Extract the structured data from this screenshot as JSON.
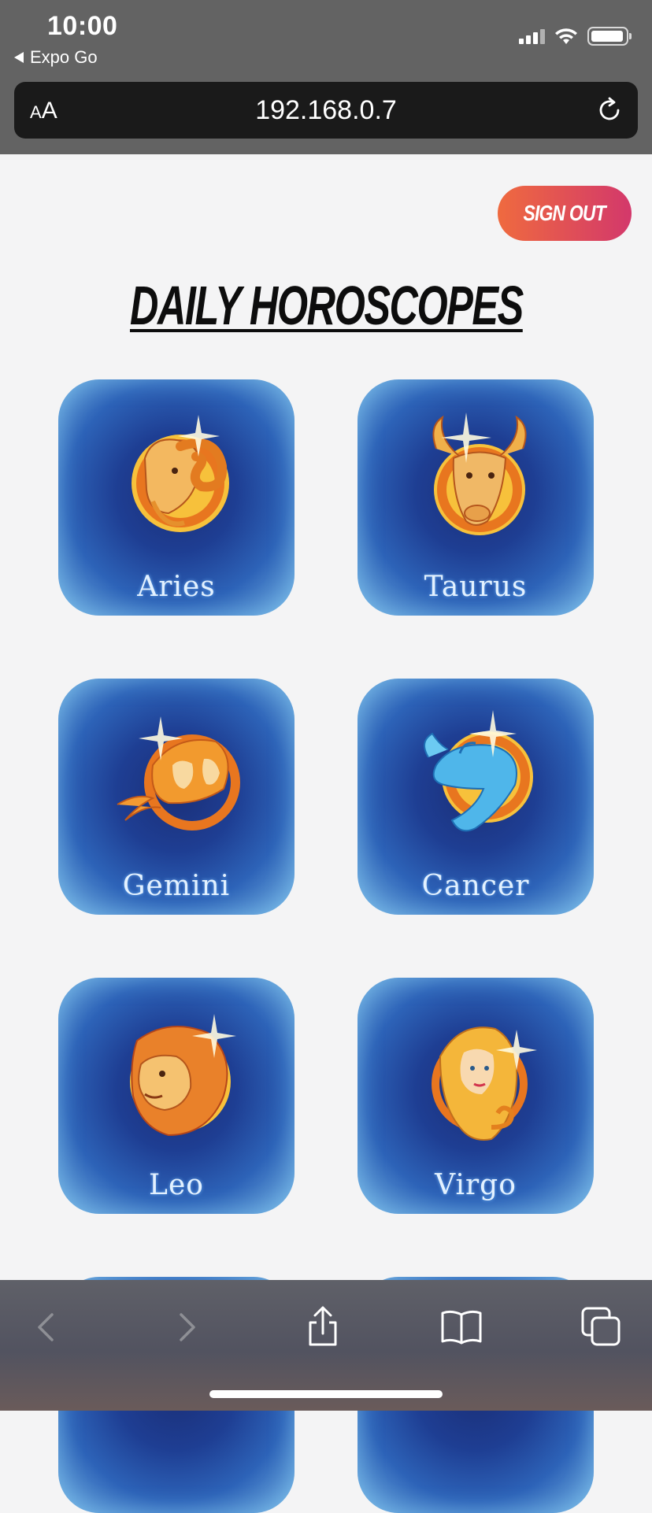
{
  "status_bar": {
    "time": "10:00",
    "back_app": "Expo Go"
  },
  "browser": {
    "text_size_small": "A",
    "text_size_large": "A",
    "url": "192.168.0.7"
  },
  "header": {
    "sign_out_label": "SIGN OUT",
    "title": "DAILY HOROSCOPES"
  },
  "signs": [
    {
      "name": "Aries",
      "icon": "aries-ram-icon"
    },
    {
      "name": "Taurus",
      "icon": "taurus-bull-icon"
    },
    {
      "name": "Gemini",
      "icon": "gemini-twins-icon"
    },
    {
      "name": "Cancer",
      "icon": "cancer-crab-icon"
    },
    {
      "name": "Leo",
      "icon": "leo-lion-icon"
    },
    {
      "name": "Virgo",
      "icon": "virgo-maiden-icon"
    }
  ],
  "toolbar": {
    "icons": [
      "back-arrow-icon",
      "forward-arrow-icon",
      "share-icon",
      "bookmarks-icon",
      "tabs-icon"
    ]
  },
  "colors": {
    "sign_out_gradient_start": "#ef6a3f",
    "sign_out_gradient_end": "#d3386b",
    "card_blue": "#1e3e93",
    "emblem_orange": "#f29a2e"
  }
}
